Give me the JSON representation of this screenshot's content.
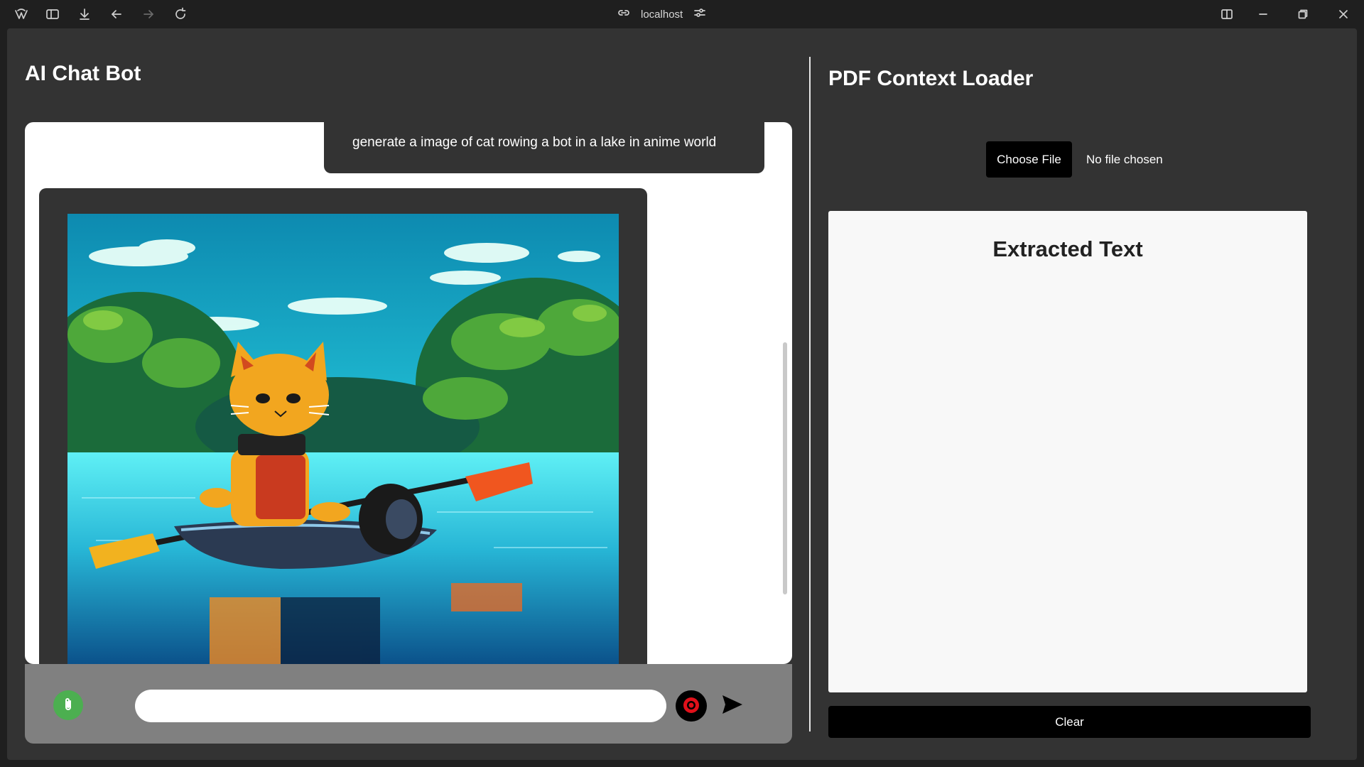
{
  "browser": {
    "address": "localhost",
    "icons": [
      "app-logo-icon",
      "sidebar-toggle-icon",
      "download-icon",
      "back-icon",
      "forward-icon",
      "reload-icon",
      "link-icon",
      "site-settings-icon",
      "split-view-icon",
      "minimize-icon",
      "restore-icon",
      "close-icon"
    ]
  },
  "chat": {
    "title": "AI Chat Bot",
    "messages": [
      {
        "role": "user",
        "text": "generate a image of cat rowing a bot in a lake in anime world"
      },
      {
        "role": "bot",
        "type": "image",
        "description_icon": "generated-image"
      }
    ],
    "input": {
      "value": "",
      "placeholder": ""
    },
    "icons": {
      "attach": "paperclip-icon",
      "record": "record-icon",
      "send": "send-icon"
    },
    "colors": {
      "attach": "#4caf50",
      "record": "#e0101a"
    }
  },
  "pdf": {
    "title": "PDF Context Loader",
    "choose_file_label": "Choose File",
    "file_status": "No file chosen",
    "extracted_title": "Extracted Text",
    "extracted_text": "",
    "clear_label": "Clear"
  }
}
